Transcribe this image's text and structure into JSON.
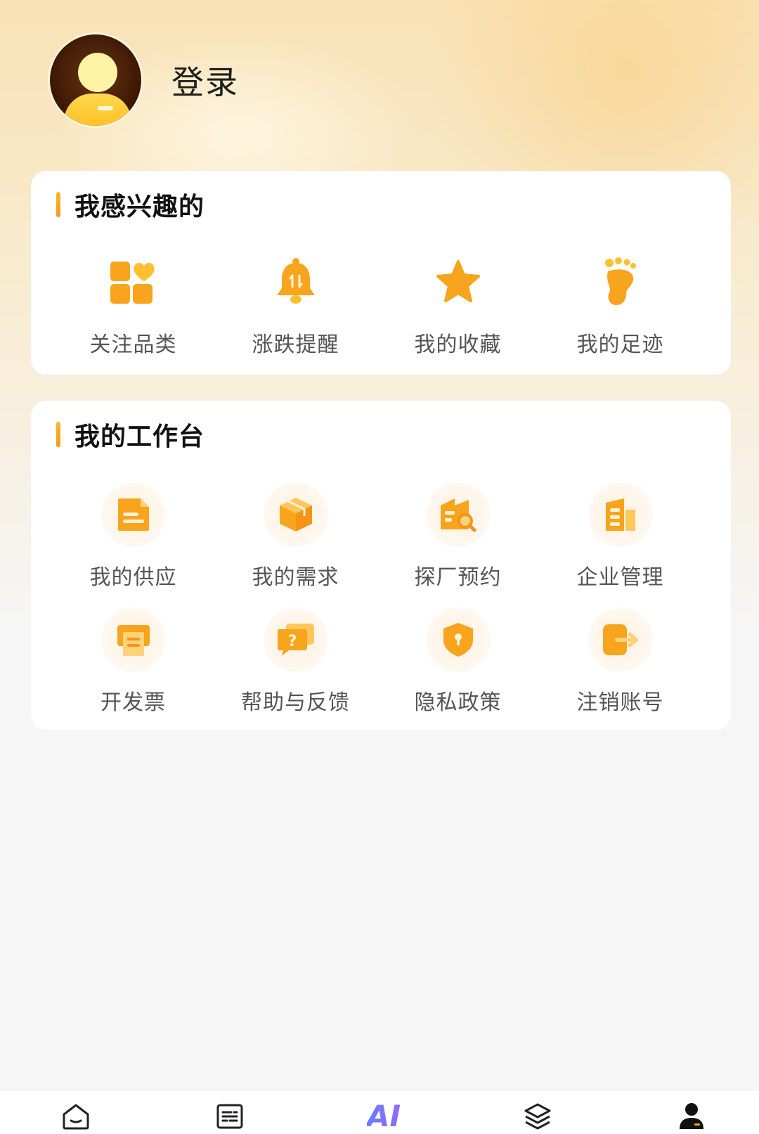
{
  "profile": {
    "login_label": "登录"
  },
  "interest": {
    "title": "我感兴趣的",
    "items": [
      {
        "label": "关注品类",
        "icon": "category-heart-icon"
      },
      {
        "label": "涨跌提醒",
        "icon": "bell-icon"
      },
      {
        "label": "我的收藏",
        "icon": "star-icon"
      },
      {
        "label": "我的足迹",
        "icon": "footprint-icon"
      }
    ]
  },
  "workbench": {
    "title": "我的工作台",
    "items": [
      {
        "label": "我的供应",
        "icon": "document-icon"
      },
      {
        "label": "我的需求",
        "icon": "box-icon"
      },
      {
        "label": "探厂预约",
        "icon": "factory-search-icon"
      },
      {
        "label": "企业管理",
        "icon": "building-icon"
      },
      {
        "label": "开发票",
        "icon": "invoice-icon"
      },
      {
        "label": "帮助与反馈",
        "icon": "help-chat-icon"
      },
      {
        "label": "隐私政策",
        "icon": "shield-icon"
      },
      {
        "label": "注销账号",
        "icon": "logout-icon"
      }
    ]
  },
  "tabbar": {
    "ai_label": "AI",
    "tabs": [
      "home-icon",
      "list-icon",
      "ai-icon",
      "layers-icon",
      "user-icon"
    ]
  },
  "colors": {
    "accent": "#f8a41c",
    "accent_light": "#ffc75a"
  }
}
